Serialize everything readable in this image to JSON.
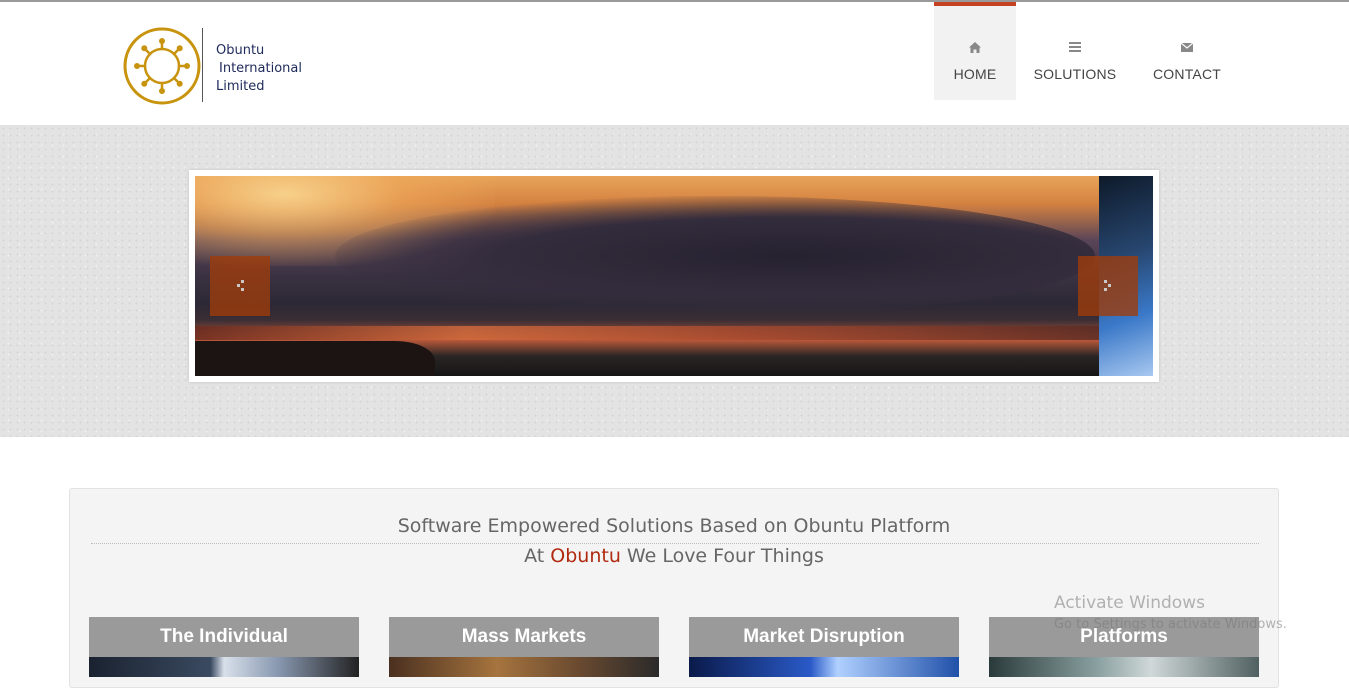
{
  "header": {
    "logo": {
      "line1": "Obuntu",
      "line2": "International",
      "line3": "Limited",
      "brand_color": "#c8940e"
    },
    "nav": [
      {
        "label": "HOME",
        "icon": "home-icon",
        "active": true
      },
      {
        "label": "SOLUTIONS",
        "icon": "list-icon",
        "active": false
      },
      {
        "label": "CONTACT",
        "icon": "envelope-icon",
        "active": false
      }
    ],
    "accent_color": "#c44322"
  },
  "slider": {
    "prev_icon": "chevron-left-icon",
    "next_icon": "chevron-right-icon"
  },
  "panel": {
    "title": "Software Empowered Solutions Based on Obuntu Platform",
    "subtitle_prefix": "At ",
    "subtitle_brand": "Obuntu",
    "subtitle_suffix": " We Love Four Things",
    "cards": [
      {
        "title": "The Individual"
      },
      {
        "title": "Mass Markets"
      },
      {
        "title": "Market Disruption"
      },
      {
        "title": "Platforms"
      }
    ]
  },
  "watermark": {
    "line1": "Activate Windows",
    "line2": "Go to Settings to activate Windows."
  }
}
